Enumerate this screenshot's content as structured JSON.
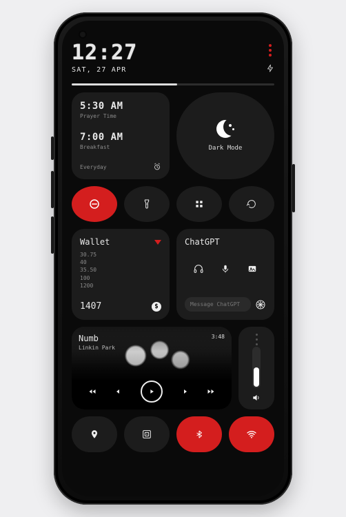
{
  "header": {
    "time": "12:27",
    "date": "SAT, 27 APR"
  },
  "progress": {
    "percent": 52
  },
  "alarms": {
    "a1_time": "5:30 AM",
    "a1_label": "Prayer Time",
    "a2_time": "7:00 AM",
    "a2_label": "Breakfast",
    "repeat": "Everyday"
  },
  "dark_mode": {
    "label": "Dark Mode"
  },
  "wallet": {
    "title": "Wallet",
    "transactions": [
      "30.75",
      "40",
      "35.50",
      "100",
      "1200"
    ],
    "total": "1407"
  },
  "chatgpt": {
    "title": "ChatGPT",
    "placeholder": "Message ChatGPT"
  },
  "music": {
    "track": "Numb",
    "artist": "Linkin Park",
    "duration": "3:48"
  },
  "colors": {
    "accent": "#d41e1e"
  }
}
